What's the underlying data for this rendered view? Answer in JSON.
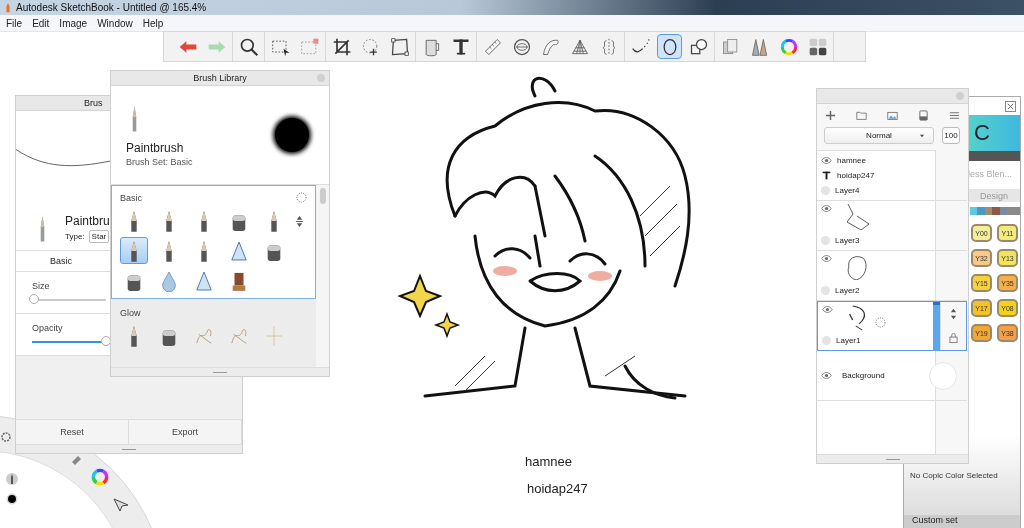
{
  "window": {
    "title": "Autodesk SketchBook - Untitled @ 165.4%"
  },
  "menu": [
    "File",
    "Edit",
    "Image",
    "Window",
    "Help"
  ],
  "toolbar": [
    [
      {
        "kind": "undo",
        "selected": false
      },
      {
        "kind": "redo",
        "selected": false
      }
    ],
    [
      {
        "kind": "zoom",
        "selected": false
      }
    ],
    [
      {
        "kind": "select",
        "selected": false
      },
      {
        "kind": "deselect",
        "selected": false
      }
    ],
    [
      {
        "kind": "crop",
        "selected": false
      },
      {
        "kind": "move",
        "selected": false
      },
      {
        "kind": "distort",
        "selected": false
      }
    ],
    [
      {
        "kind": "fill",
        "selected": false
      },
      {
        "kind": "text",
        "selected": false
      }
    ],
    [
      {
        "kind": "ruler",
        "selected": false
      },
      {
        "kind": "ellipse",
        "selected": false
      },
      {
        "kind": "curve",
        "selected": false
      },
      {
        "kind": "perspective",
        "selected": false
      },
      {
        "kind": "symmetry",
        "selected": false
      }
    ],
    [
      {
        "kind": "stroke",
        "selected": false
      },
      {
        "kind": "circle",
        "selected": true
      },
      {
        "kind": "shapes",
        "selected": false
      }
    ],
    [
      {
        "kind": "copy",
        "selected": false
      },
      {
        "kind": "brushes",
        "selected": false
      },
      {
        "kind": "colors",
        "selected": false
      },
      {
        "kind": "swatches",
        "selected": false
      }
    ]
  ],
  "brush_properties": {
    "title": "Brus",
    "brush_name": "Paintbru",
    "type_label": "Type:",
    "type_value": "Star",
    "tab": "Basic",
    "sliders": [
      {
        "label": "Size",
        "level": 0.03
      },
      {
        "label": "Opacity",
        "level": 1
      }
    ],
    "buttons": [
      "Reset",
      "Export"
    ]
  },
  "brush_library": {
    "title": "Brush Library",
    "current": {
      "name": "Paintbrush",
      "set": "Brush Set: Basic"
    },
    "groups": [
      {
        "name": "Basic",
        "selected": true,
        "brushes": [
          {
            "kind": "tip",
            "selected": false
          },
          {
            "kind": "tip",
            "selected": false
          },
          {
            "kind": "tip",
            "selected": false
          },
          {
            "kind": "block",
            "selected": false
          },
          {
            "kind": "tip",
            "selected": false
          },
          {
            "kind": "tip",
            "selected": true
          },
          {
            "kind": "tip",
            "selected": false
          },
          {
            "kind": "tip",
            "selected": false
          },
          {
            "kind": "triangle",
            "selected": false
          },
          {
            "kind": "block",
            "selected": false
          },
          {
            "kind": "block",
            "selected": false
          },
          {
            "kind": "drop",
            "selected": false
          },
          {
            "kind": "triangle",
            "selected": false
          },
          {
            "kind": "stamp",
            "selected": false
          }
        ]
      },
      {
        "name": "Glow",
        "selected": false,
        "brushes": [
          {
            "kind": "tip",
            "selected": false
          },
          {
            "kind": "block",
            "selected": false
          },
          {
            "kind": "scribble",
            "selected": false
          },
          {
            "kind": "scribble",
            "selected": false
          },
          {
            "kind": "sparkle",
            "selected": false
          }
        ]
      }
    ]
  },
  "canvas": {
    "texts": [
      "hamnee",
      "hoidap247"
    ]
  },
  "layers": {
    "blend_mode": "Normal",
    "opacity": "100",
    "items": [
      {
        "name": "Layer4",
        "kind": "paint",
        "selected": false,
        "text_layers": [
          "hamnee",
          "hoidap247"
        ]
      },
      {
        "name": "Layer3",
        "kind": "paint",
        "selected": false
      },
      {
        "name": "Layer2",
        "kind": "paint",
        "selected": false
      },
      {
        "name": "Layer1",
        "kind": "paint",
        "selected": true
      },
      {
        "name": "Background",
        "kind": "background",
        "selected": false
      }
    ]
  },
  "copic": {
    "logo": "C",
    "mode": "less Blen...",
    "tab": "Design",
    "colors": [
      {
        "code": "Y00",
        "color": "#f4ee9c"
      },
      {
        "code": "Y11",
        "color": "#f3e97c"
      },
      {
        "code": "Y32",
        "color": "#f7c98a"
      },
      {
        "code": "Y13",
        "color": "#f4e35c"
      },
      {
        "code": "Y15",
        "color": "#f7d13c"
      },
      {
        "code": "Y35",
        "color": "#f5b04a"
      },
      {
        "code": "Y17",
        "color": "#f3c22a"
      },
      {
        "code": "Y08",
        "color": "#f5d21a"
      },
      {
        "code": "Y19",
        "color": "#f2a634"
      },
      {
        "code": "Y38",
        "color": "#f59f4a"
      }
    ],
    "status": "No Copic Color Selected",
    "set": "Custom set"
  }
}
